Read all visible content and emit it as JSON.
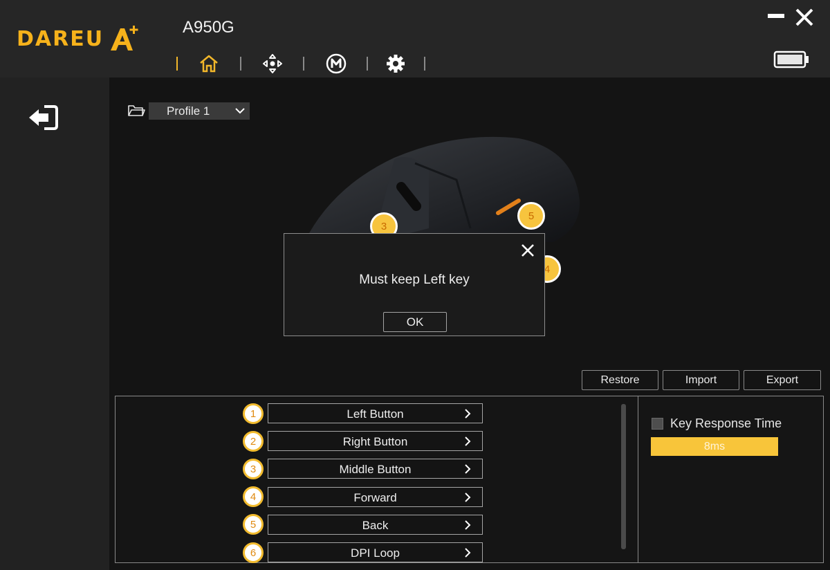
{
  "app": {
    "brand": "DAREU A+",
    "model": "A950G"
  },
  "nav": {
    "tabs": [
      {
        "name": "home",
        "icon": "home-icon",
        "active": true
      },
      {
        "name": "move",
        "icon": "move-arrows-icon"
      },
      {
        "name": "macro",
        "icon": "macro-m-icon"
      },
      {
        "name": "settings",
        "icon": "gear-icon"
      }
    ]
  },
  "profile": {
    "selected": "Profile 1"
  },
  "mouse_badges": [
    "3",
    "5",
    "4"
  ],
  "dialog": {
    "message": "Must keep Left key",
    "ok_label": "OK"
  },
  "actions": {
    "restore": "Restore",
    "import": "Import",
    "export": "Export"
  },
  "buttons": [
    {
      "num": "1",
      "label": "Left Button"
    },
    {
      "num": "2",
      "label": "Right Button"
    },
    {
      "num": "3",
      "label": "Middle Button"
    },
    {
      "num": "4",
      "label": "Forward"
    },
    {
      "num": "5",
      "label": "Back"
    },
    {
      "num": "6",
      "label": "DPI Loop"
    }
  ],
  "key_response": {
    "label": "Key Response Time",
    "value": "8ms",
    "checked": false
  },
  "colors": {
    "accent": "#f8c53a",
    "background": "#141414",
    "topbar": "#262626"
  }
}
